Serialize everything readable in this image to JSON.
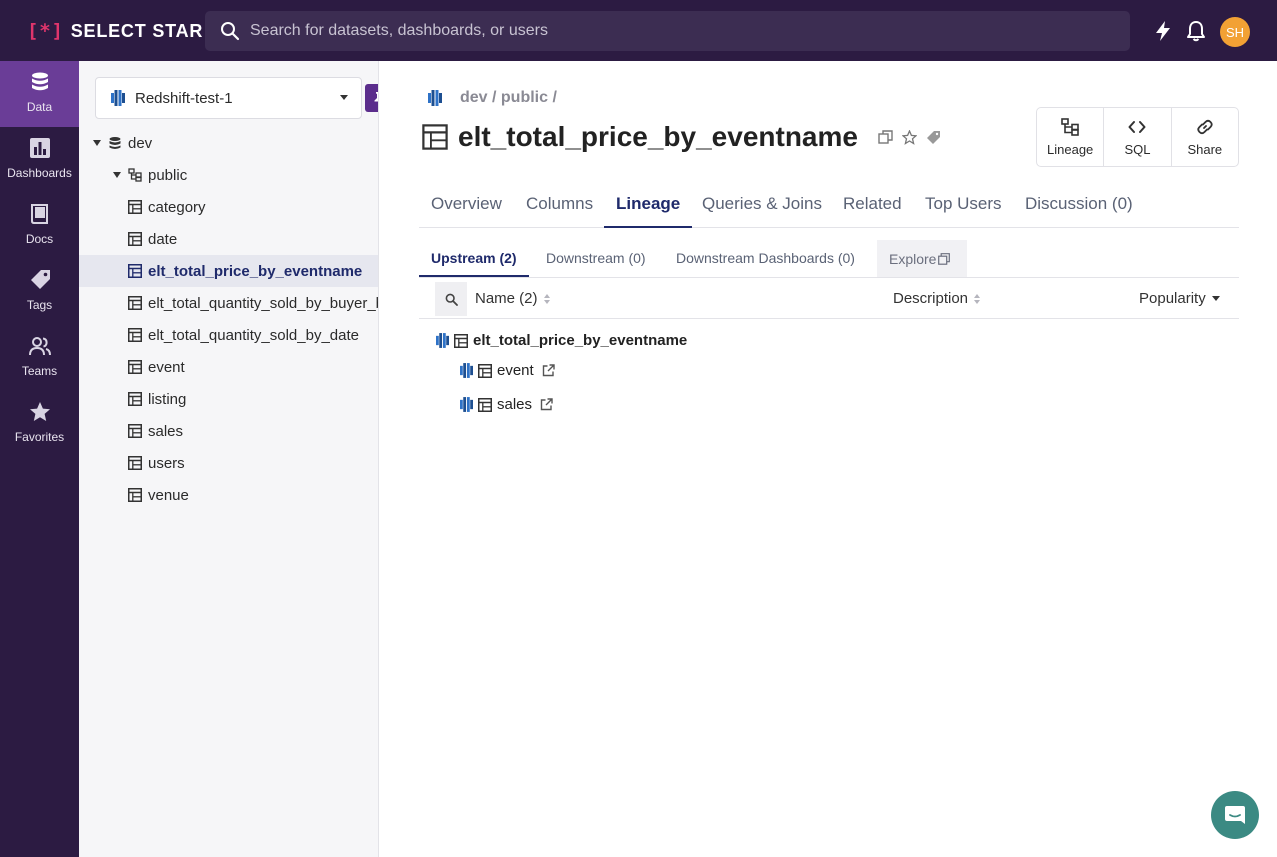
{
  "app": {
    "logo_bracket": "[*]",
    "logo_text": "SELECT STAR"
  },
  "search": {
    "placeholder": "Search for datasets, dashboards, or users"
  },
  "user": {
    "initials": "SH",
    "avatar_color": "#f2a134"
  },
  "colors": {
    "brand_dark": "#2c1b42",
    "nav_active": "#6a3d97",
    "accent_text": "#1f2a6b",
    "logo_accent": "#e0356c",
    "redshift_blue": "#2e72c7",
    "chat_button": "#3b8a83"
  },
  "leftnav": {
    "items": [
      {
        "label": "Data",
        "icon": "database-icon",
        "active": true
      },
      {
        "label": "Dashboards",
        "icon": "bar-chart-icon"
      },
      {
        "label": "Docs",
        "icon": "book-icon"
      },
      {
        "label": "Tags",
        "icon": "tag-icon"
      },
      {
        "label": "Teams",
        "icon": "users-icon"
      },
      {
        "label": "Favorites",
        "icon": "star-icon"
      }
    ]
  },
  "sidebar": {
    "selected_db": "Redshift-test-1",
    "tree": [
      {
        "label": "dev",
        "icon": "database-icon",
        "expanded": true
      },
      {
        "label": "public",
        "icon": "schema-icon",
        "expanded": true
      },
      {
        "label": "category",
        "icon": "table-icon"
      },
      {
        "label": "date",
        "icon": "table-icon"
      },
      {
        "label": "elt_total_price_by_eventname",
        "icon": "table-icon",
        "selected": true
      },
      {
        "label": "elt_total_quantity_sold_by_buyer_by_date",
        "icon": "table-icon"
      },
      {
        "label": "elt_total_quantity_sold_by_date",
        "icon": "table-icon"
      },
      {
        "label": "event",
        "icon": "table-icon"
      },
      {
        "label": "listing",
        "icon": "table-icon"
      },
      {
        "label": "sales",
        "icon": "table-icon"
      },
      {
        "label": "users",
        "icon": "table-icon"
      },
      {
        "label": "venue",
        "icon": "table-icon"
      }
    ]
  },
  "main": {
    "breadcrumb": "dev / public /",
    "title": "elt_total_price_by_eventname",
    "actions": [
      {
        "label": "Lineage",
        "icon": "lineage-icon"
      },
      {
        "label": "SQL",
        "icon": "code-icon"
      },
      {
        "label": "Share",
        "icon": "link-icon"
      }
    ],
    "tabs": [
      {
        "label": "Overview"
      },
      {
        "label": "Columns"
      },
      {
        "label": "Lineage",
        "active": true
      },
      {
        "label": "Queries & Joins"
      },
      {
        "label": "Related"
      },
      {
        "label": "Top Users"
      },
      {
        "label": "Discussion (0)"
      }
    ],
    "subtabs": [
      {
        "label": "Upstream (2)",
        "active": true
      },
      {
        "label": "Downstream (0)"
      },
      {
        "label": "Downstream Dashboards (0)"
      },
      {
        "label": "Explore"
      }
    ],
    "table": {
      "headers": {
        "name": "Name (2)",
        "description": "Description",
        "popularity": "Popularity"
      },
      "root": "elt_total_price_by_eventname",
      "rows": [
        {
          "name": "event"
        },
        {
          "name": "sales"
        }
      ]
    }
  }
}
